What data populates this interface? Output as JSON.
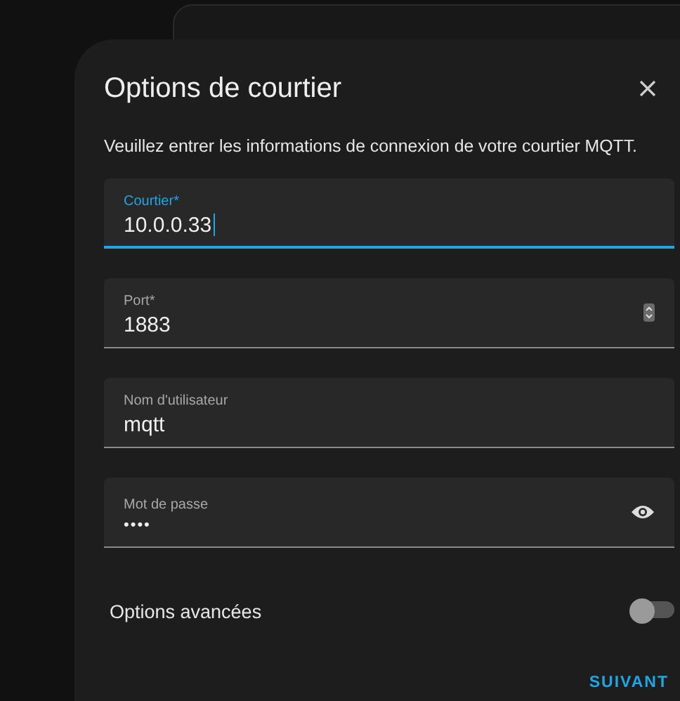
{
  "dialog": {
    "title": "Options de courtier",
    "description": "Veuillez entrer les informations de connexion de votre courtier MQTT.",
    "fields": [
      {
        "kind": "text",
        "label": "Courtier*",
        "value": "10.0.0.33",
        "focused": true
      },
      {
        "kind": "number",
        "label": "Port*",
        "value": "1883",
        "focused": false
      },
      {
        "kind": "text",
        "label": "Nom d'utilisateur",
        "value": "mqtt",
        "focused": false
      },
      {
        "kind": "password",
        "label": "Mot de passe",
        "value": "••••",
        "focused": false
      }
    ],
    "toggle": {
      "label": "Options avancées",
      "on": false
    },
    "buttons": [
      {
        "label": "SUIVANT"
      }
    ]
  }
}
